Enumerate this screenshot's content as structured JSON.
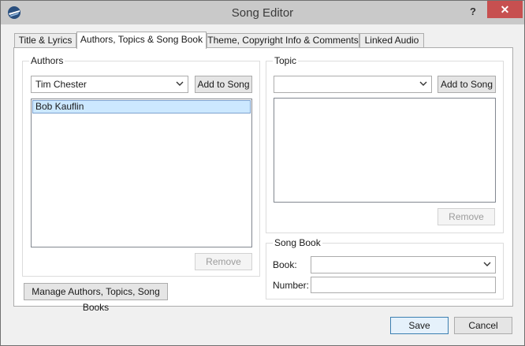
{
  "window": {
    "title": "Song Editor",
    "help_symbol": "?",
    "close_symbol": "✕"
  },
  "tabs": [
    {
      "label": "Title & Lyrics",
      "active": false
    },
    {
      "label": "Authors, Topics & Song Book",
      "active": true
    },
    {
      "label": "Theme, Copyright Info & Comments",
      "active": false
    },
    {
      "label": "Linked Audio",
      "active": false
    }
  ],
  "authors": {
    "group_title": "Authors",
    "selected_author": "Tim Chester",
    "add_button": "Add to Song",
    "list_items": [
      "Bob Kauflin"
    ],
    "remove_button": "Remove"
  },
  "manage_button": "Manage Authors, Topics, Song Books",
  "topic": {
    "group_title": "Topic",
    "selected_topic": "",
    "add_button": "Add to Song",
    "list_items": [],
    "remove_button": "Remove"
  },
  "songbook": {
    "group_title": "Song Book",
    "book_label": "Book:",
    "book_value": "",
    "number_label": "Number:",
    "number_value": ""
  },
  "footer": {
    "save_button": "Save",
    "cancel_button": "Cancel"
  },
  "colors": {
    "close_button": "#c75050",
    "selection_fill": "#cce8ff",
    "selection_border": "#7da2ce",
    "default_button_border": "#3c7fb1"
  }
}
